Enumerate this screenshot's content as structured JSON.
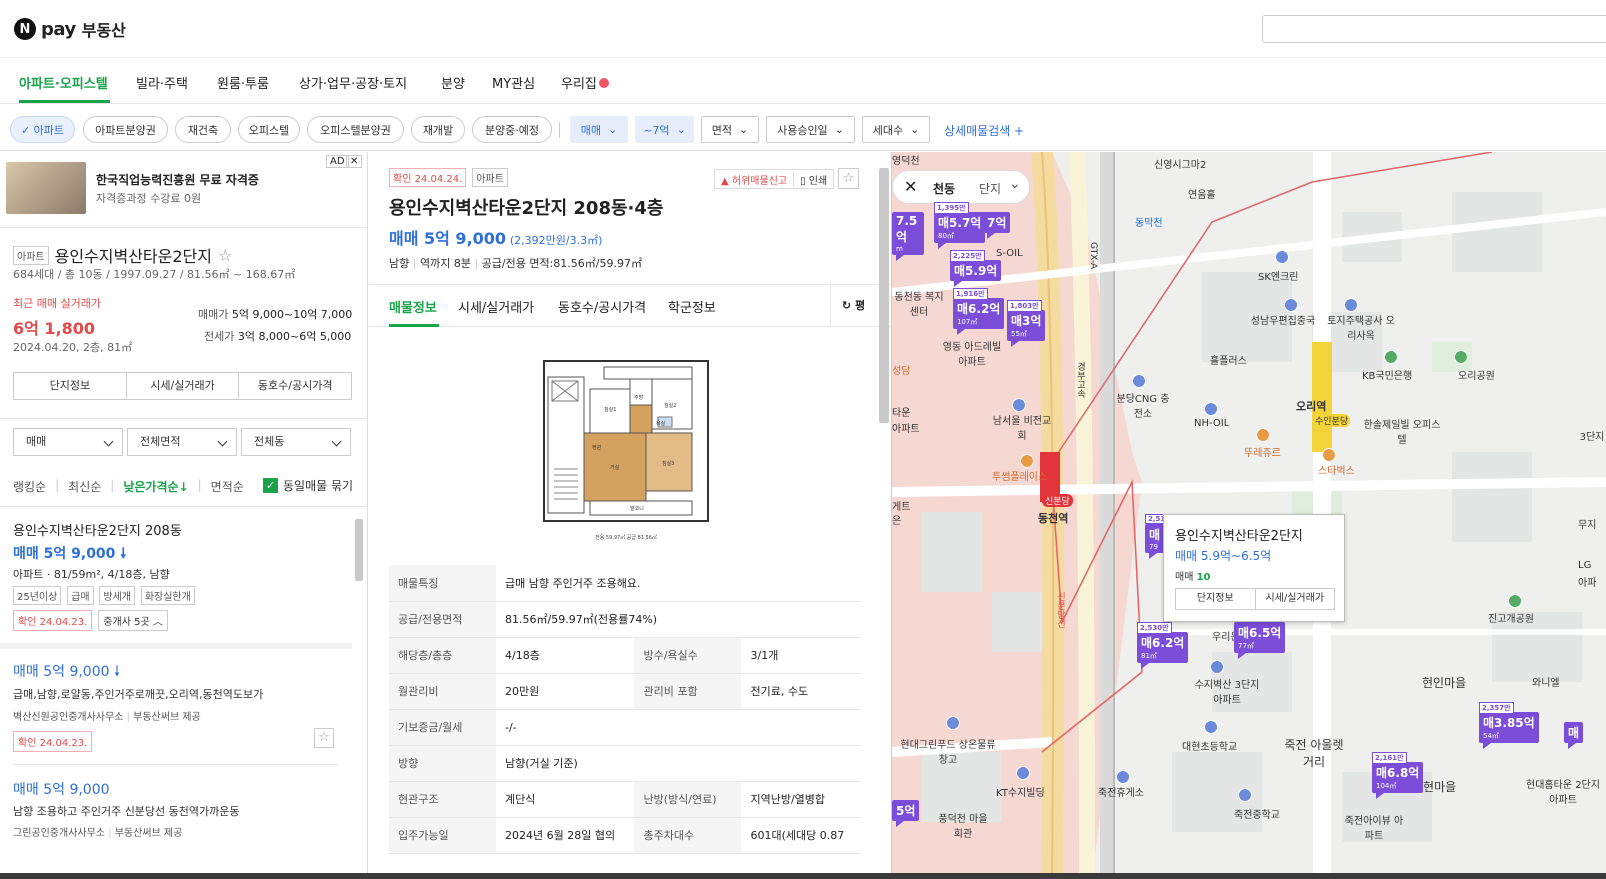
{
  "header": {
    "logo_n": "N",
    "logo_pay": "pay",
    "logo_title": "부동산",
    "search_placeholder": ""
  },
  "nav": {
    "tabs": [
      "아파트·오피스텔",
      "빌라·주택",
      "원룸·투룸",
      "상가·업무·공장·토지",
      "분양",
      "MY관심",
      "우리집"
    ]
  },
  "filters": {
    "pills": [
      "✓ 아파트",
      "아파트분양권",
      "재건축",
      "오피스텔",
      "오피스텔분양권",
      "재개발",
      "분양중·예정"
    ],
    "selects": [
      "매매",
      "~7억",
      "면적",
      "사용승인일",
      "세대수"
    ],
    "advanced": "상세매물검색 +"
  },
  "ad": {
    "badge": "AD",
    "close": "✕",
    "title": "한국직업능력진흥원 무료 자격증",
    "sub": "자격증과정 수강료 0원"
  },
  "complex": {
    "type": "아파트",
    "name": "용인수지벽산타운2단지",
    "star": "☆",
    "info": "684세대 / 총 10동 / 1997.09.27 / 81.56㎡ ~ 168.67㎡",
    "recent_label": "최근 매매 실거래가",
    "recent_price": "6억 1,800",
    "recent_date": "2024.04.20, 2층, 81㎡",
    "sale_label": "매매가",
    "sale_range": "5억 9,000~10억 7,000",
    "jeonse_label": "전세가",
    "jeonse_range": "3억 8,000~6억 5,000",
    "buttons": [
      "단지정보",
      "시세/실거래가",
      "동호수/공시가격"
    ]
  },
  "listfilter": {
    "dropdowns": [
      "매매",
      "전체면적",
      "전체동"
    ],
    "sorts": [
      "랭킹순",
      "최신순",
      "낮은가격순↓",
      "면적순"
    ],
    "group_label": "동일매물 묶기"
  },
  "listings": [
    {
      "title": "용인수지벽산타운2단지 208동",
      "price": "매매 5억 9,000",
      "arrow": "🠗",
      "spec": "아파트 · 81/59m², 4/18층, 남향",
      "tags": [
        "25년이상",
        "급매",
        "방세개",
        "화장실한개"
      ],
      "confirm": "확인 24.04.23.",
      "agents": "중개사 5곳 ︿"
    },
    {
      "price": "매매 5억 9,000",
      "arrow": "🠗",
      "desc": "급매,남향,로얄동,주인거주로깨끗,오리역,동천역도보가",
      "agency": "벽산신원공인중개사사무소",
      "provider": "부동산써브 제공",
      "confirm": "확인 24.04.23."
    },
    {
      "price": "매매 5억 9,000",
      "desc": "남향 조용하고 주인거주 신분당선 동천역가까운동",
      "agency": "그린공인중개사사무소",
      "provider": "부동산써브 제공"
    }
  ],
  "detail": {
    "confirm": "확인 24.04.24.",
    "type": "아파트",
    "report": "허위매물신고",
    "print": "인쇄",
    "title": "용인수지벽산타운2단지 208동·4층",
    "price": "매매 5억 9,000",
    "price_sub": "(2,392만원/3.3㎡)",
    "summary": [
      "남향",
      "역까지 8분",
      "공급/전용 면적:81.56㎡/59.97㎡"
    ],
    "tabs": [
      "매물정보",
      "시세/실거래가",
      "동호수/공시가격",
      "학군정보"
    ],
    "refresh": "평",
    "floorplan": {
      "rooms": [
        "침실1",
        "침실2",
        "거실",
        "침실3",
        "주방",
        "욕실",
        "현관",
        "발코니"
      ],
      "caption": "전용 59.97㎡ 공급 81.56㎡"
    },
    "table": [
      {
        "k": "매물특징",
        "v": "급매 남향 주인거주 조용해요."
      },
      {
        "k": "공급/전용면적",
        "v": "81.56㎡/59.97㎡(전용률74%)"
      },
      {
        "k": "해당층/총층",
        "v": "4/18층",
        "k2": "방수/욕실수",
        "v2": "3/1개"
      },
      {
        "k": "월관리비",
        "v": "20만원",
        "k2": "관리비 포함",
        "v2": "전기료, 수도"
      },
      {
        "k": "기보증금/월세",
        "v": "-/-"
      },
      {
        "k": "방향",
        "v": "남향(거실 기준)"
      },
      {
        "k": "현관구조",
        "v": "계단식",
        "k2": "난방(방식/연료)",
        "v2": "지역난방/열병합"
      },
      {
        "k": "입주가능일",
        "v": "2024년 6월 28일 협의",
        "k2": "총주차대수",
        "v2": "601대(세대당 0.87"
      }
    ]
  },
  "map": {
    "search_text": "천동",
    "search_mode": "단지",
    "close": "✕",
    "markers": [
      {
        "tag": "",
        "price": "7.5억",
        "size": "m"
      },
      {
        "tag": "1,395만",
        "price": "매5.7억",
        "size": "80㎡"
      },
      {
        "tag": "",
        "price": "7억",
        "size": ""
      },
      {
        "tag": "2,225만",
        "price": "매5.9억",
        "size": ""
      },
      {
        "tag": "1,916만",
        "price": "매6.2억",
        "size": "107㎡"
      },
      {
        "tag": "1,803만",
        "price": "매3억",
        "size": "55㎡"
      },
      {
        "tag": "2,51",
        "price": "매",
        "size": "79"
      },
      {
        "tag": "2,530만",
        "price": "매6.2억",
        "size": "81㎡"
      },
      {
        "tag": "",
        "price": "매6.5억",
        "size": "77㎡"
      },
      {
        "tag": "2,357만",
        "price": "매3.85억",
        "size": "54㎡"
      },
      {
        "tag": "2,161만",
        "price": "매6.8억",
        "size": "104㎡"
      },
      {
        "tag": "",
        "price": "5억",
        "size": ""
      },
      {
        "tag": "",
        "price": "매",
        "size": ""
      }
    ],
    "popup": {
      "title": "용인수지벽산타운2단지",
      "price": "매매 5.9억~6.5억",
      "count_label": "매매",
      "count": "10",
      "buttons": [
        "단지정보",
        "시세/실거래가"
      ]
    },
    "labels": [
      "신영시그마2",
      "연움홀",
      "동막천",
      "SK엔크린",
      "성남우편집중국",
      "토지주택공사 오리사옥",
      "KB국민은행",
      "오리공원",
      "흘플러스",
      "분당CNG 충전소",
      "NH-OIL",
      "오리역",
      "뚜레쥬르",
      "한솔제일빌 오피스텔",
      "스타벅스",
      "남서울 비전교회",
      "투썸플레이스",
      "동천역",
      "신분당",
      "우리은행",
      "수지벽산 3단지아파트",
      "현인마을",
      "진고개공원",
      "대현초등학교",
      "죽전 아울렛거리",
      "죽전휴게소",
      "죽전중학교",
      "KT수지빌딩",
      "현대그린푸드 상온물류창고",
      "풍덕천 마을회관",
      "현대홈타운 2단지아파트",
      "죽전아이뷰 아파트",
      "인현마을",
      "와니엘",
      "동천동 복지센터",
      "영동 아드레빌 아파트",
      "S-OIL",
      "경부고속",
      "GTX-A",
      "신분당선",
      "오리역",
      "수인분당",
      "3단지",
      "무지",
      "LG",
      "아파",
      "타운",
      "아파트",
      "센터",
      "은",
      "게트",
      "성담",
      "영덕천"
    ]
  }
}
